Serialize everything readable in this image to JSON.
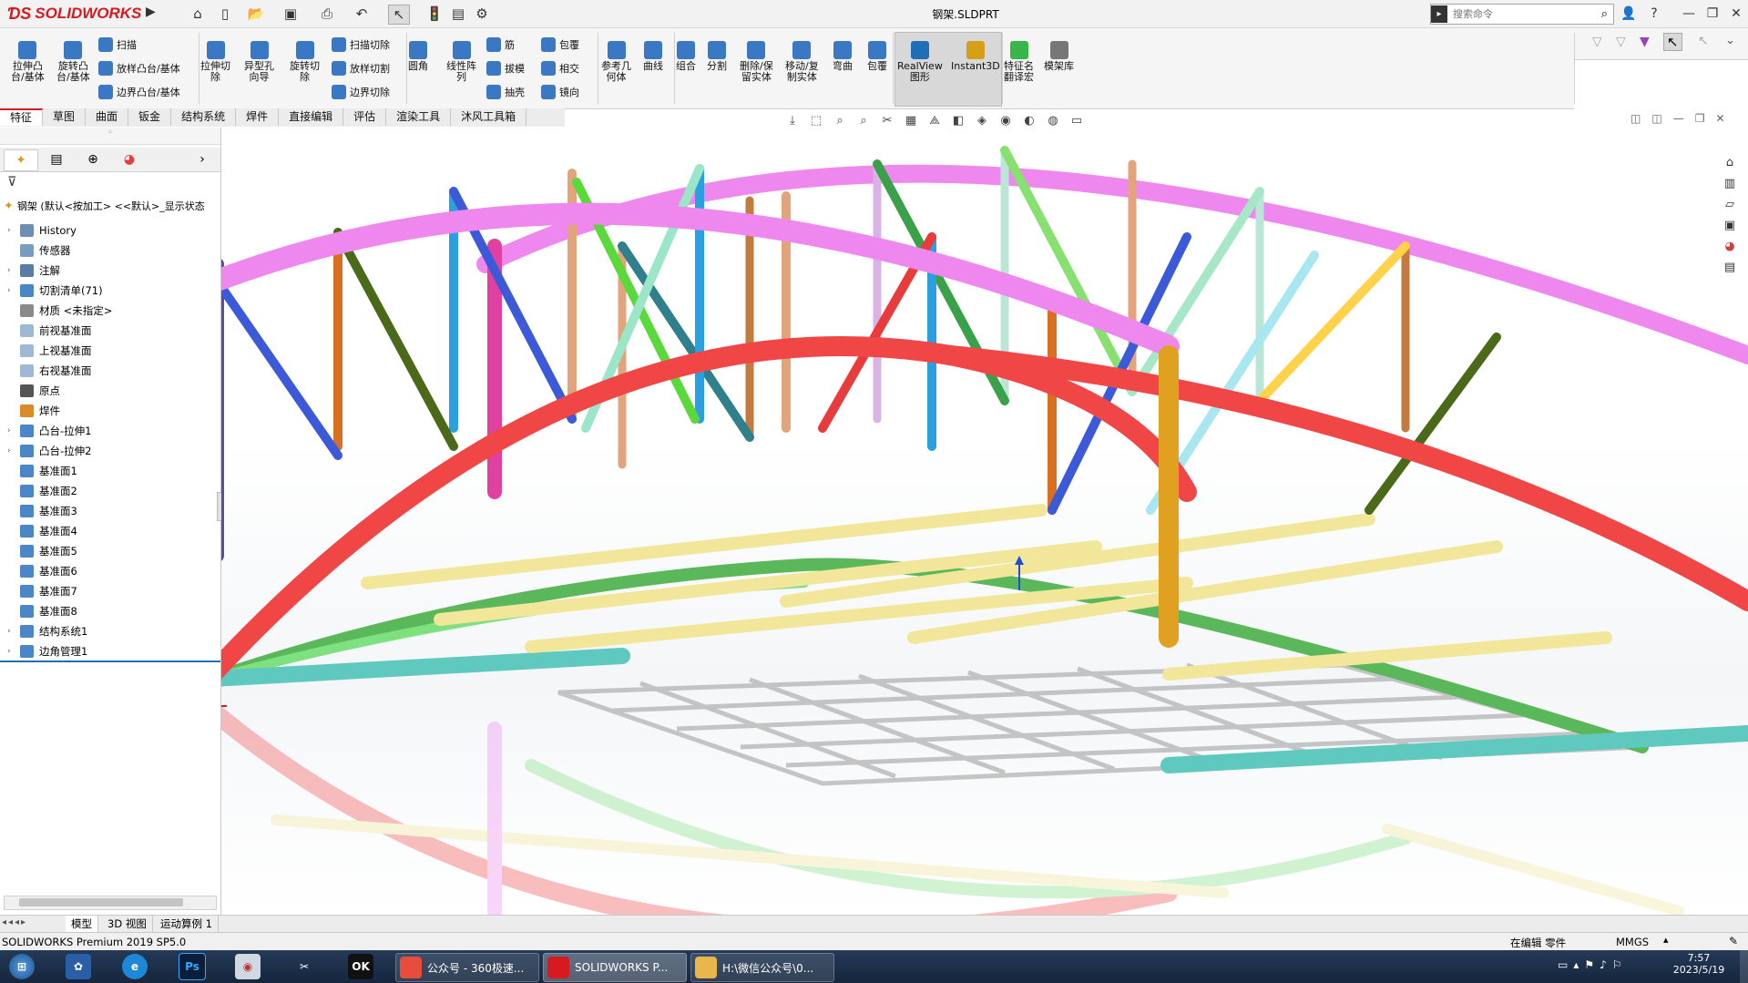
{
  "app": {
    "logo": "SOLIDWORKS",
    "doc_title": "钢架.SLDPRT",
    "search_placeholder": "搜索命令"
  },
  "ribbon": {
    "big": [
      {
        "label": "拉伸凸\n台/基体",
        "color": "#3a78c4"
      },
      {
        "label": "旋转凸\n台/基体",
        "color": "#3a78c4"
      },
      {
        "label": "拉伸切\n除",
        "color": "#3a78c4"
      },
      {
        "label": "异型孔\n向导",
        "color": "#3a78c4"
      },
      {
        "label": "旋转切\n除",
        "color": "#3a78c4"
      },
      {
        "label": "圆角",
        "color": "#3a78c4"
      },
      {
        "label": "线性阵\n列",
        "color": "#3a78c4"
      },
      {
        "label": "参考几\n何体",
        "color": "#3a78c4"
      },
      {
        "label": "曲线",
        "color": "#3a78c4"
      },
      {
        "label": "组合",
        "color": "#3a78c4"
      },
      {
        "label": "分割",
        "color": "#3a78c4"
      },
      {
        "label": "删除/保\n留实体",
        "color": "#3a78c4"
      },
      {
        "label": "移动/复\n制实体",
        "color": "#3a78c4"
      },
      {
        "label": "弯曲",
        "color": "#3a78c4"
      },
      {
        "label": "包覆",
        "color": "#3a78c4"
      },
      {
        "label": "RealView\n图形",
        "color": "#1e6fb8"
      },
      {
        "label": "Instant3D",
        "color": "#d4a017"
      },
      {
        "label": "特征名\n翻译宏",
        "color": "#39b54a"
      },
      {
        "label": "模架库",
        "color": "#777777"
      }
    ],
    "small": [
      {
        "label": "扫描"
      },
      {
        "label": "放样凸台/基体"
      },
      {
        "label": "边界凸台/基体"
      },
      {
        "label": "扫描切除"
      },
      {
        "label": "放样切割"
      },
      {
        "label": "边界切除"
      },
      {
        "label": "筋"
      },
      {
        "label": "拔模"
      },
      {
        "label": "抽壳"
      },
      {
        "label": "包覆"
      },
      {
        "label": "相交"
      },
      {
        "label": "镜向"
      }
    ]
  },
  "tabs": [
    "特征",
    "草图",
    "曲面",
    "钣金",
    "结构系统",
    "焊件",
    "直接编辑",
    "评估",
    "渲染工具",
    "沐风工具箱"
  ],
  "tree": {
    "root": "钢架 (默认<按加工> <<默认>_显示状态",
    "items": [
      {
        "label": "History",
        "arrow": true,
        "color": "#6d8fb3"
      },
      {
        "label": "传感器",
        "arrow": false,
        "color": "#7a9cbf"
      },
      {
        "label": "注解",
        "arrow": true,
        "color": "#5a7ea3"
      },
      {
        "label": "切割清单(71)",
        "arrow": true,
        "color": "#4a86c8"
      },
      {
        "label": "材质 <未指定>",
        "arrow": false,
        "color": "#8a8a8a"
      },
      {
        "label": "前视基准面",
        "arrow": false,
        "color": "#9fb8d3"
      },
      {
        "label": "上视基准面",
        "arrow": false,
        "color": "#9fb8d3"
      },
      {
        "label": "右视基准面",
        "arrow": false,
        "color": "#9fb8d3"
      },
      {
        "label": "原点",
        "arrow": false,
        "color": "#555555"
      },
      {
        "label": "焊件",
        "arrow": false,
        "color": "#d98a2b"
      },
      {
        "label": "凸台-拉伸1",
        "arrow": true,
        "color": "#4a86c8"
      },
      {
        "label": "凸台-拉伸2",
        "arrow": true,
        "color": "#4a86c8"
      },
      {
        "label": "基准面1",
        "arrow": false,
        "color": "#4a86c8"
      },
      {
        "label": "基准面2",
        "arrow": false,
        "color": "#4a86c8"
      },
      {
        "label": "基准面3",
        "arrow": false,
        "color": "#4a86c8"
      },
      {
        "label": "基准面4",
        "arrow": false,
        "color": "#4a86c8"
      },
      {
        "label": "基准面5",
        "arrow": false,
        "color": "#4a86c8"
      },
      {
        "label": "基准面6",
        "arrow": false,
        "color": "#4a86c8"
      },
      {
        "label": "基准面7",
        "arrow": false,
        "color": "#4a86c8"
      },
      {
        "label": "基准面8",
        "arrow": false,
        "color": "#4a86c8"
      },
      {
        "label": "结构系统1",
        "arrow": true,
        "color": "#4a86c8"
      },
      {
        "label": "边角管理1",
        "arrow": true,
        "color": "#4a86c8"
      }
    ]
  },
  "bottom_tabs": [
    "模型",
    "3D 视图",
    "运动算例 1"
  ],
  "status": {
    "left": "SOLIDWORKS Premium 2019 SP5.0",
    "edit": "在编辑 零件",
    "units": "MMGS"
  },
  "taskbar": {
    "windows": [
      {
        "label": "公众号 - 360极速...",
        "color": "#e84c3d"
      },
      {
        "label": "SOLIDWORKS P...",
        "color": "#d71920"
      },
      {
        "label": "H:\\微信公众号\\0...",
        "color": "#e8b64c"
      }
    ],
    "time": "7:57",
    "date": "2023/5/19"
  },
  "colors": {
    "arch_front": "#f04646",
    "arch_back": "#ee88ee",
    "base_long": "#7fe07f",
    "cross": "#f1e69a",
    "base_cyan": "#5fc9c0"
  }
}
